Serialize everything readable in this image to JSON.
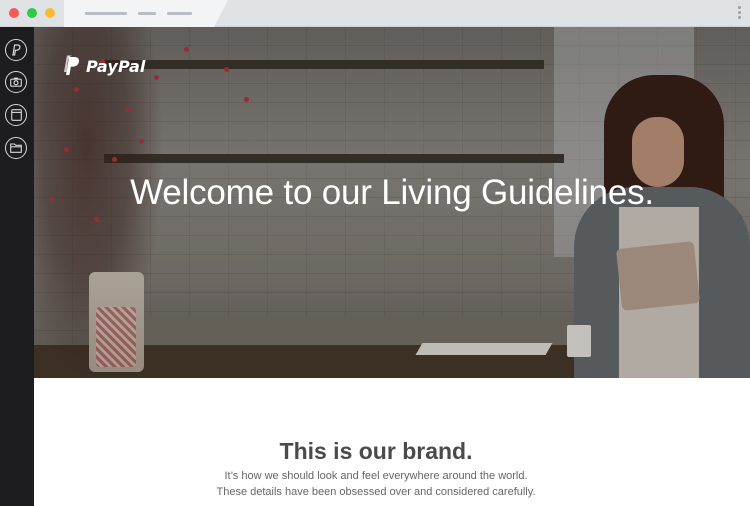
{
  "browser": {
    "buttons": [
      "close",
      "minimize",
      "maximize"
    ],
    "menu_icon": "kebab-menu-icon"
  },
  "sidebar": {
    "items": [
      {
        "icon": "paypal-icon"
      },
      {
        "icon": "camera-icon"
      },
      {
        "icon": "document-icon"
      },
      {
        "icon": "folder-icon"
      }
    ]
  },
  "hero": {
    "logo_text": "PayPal",
    "title": "Welcome to our Living Guidelines."
  },
  "brand": {
    "title": "This is our brand.",
    "line1": "It’s how we should look and feel everywhere around the world.",
    "line2": "These details have been obsessed over and considered carefully."
  },
  "colors": {
    "chrome": "#dfe2e5",
    "sidebar": "#1d1d1f",
    "close": "#f25b57",
    "minimize": "#33c748",
    "maximize": "#fcbb2e"
  }
}
